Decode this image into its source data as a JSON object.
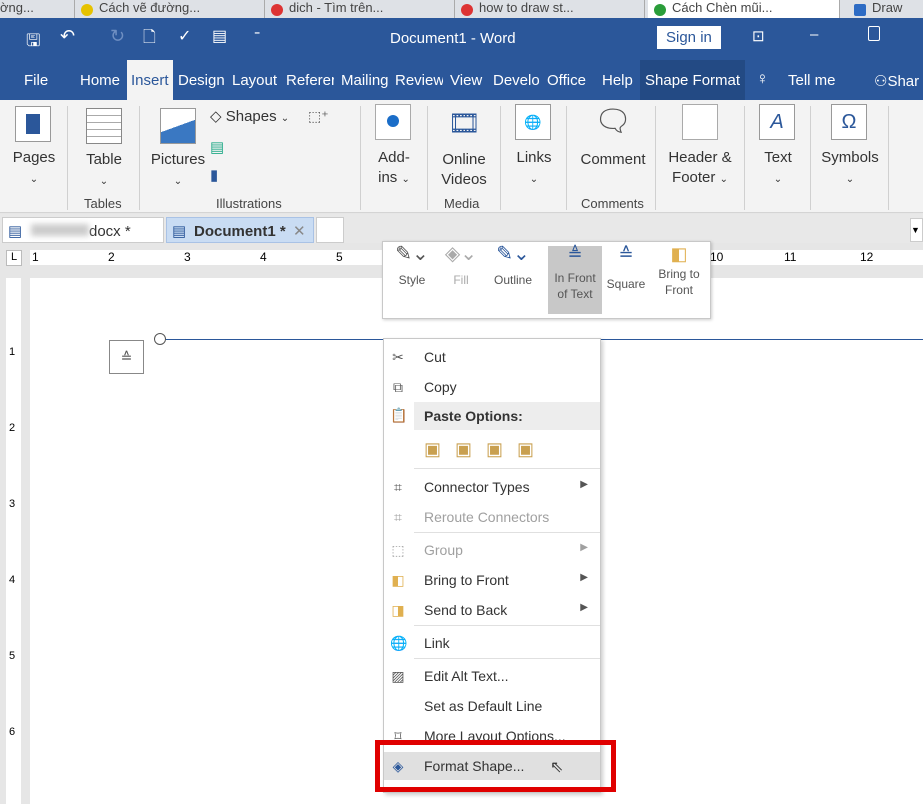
{
  "browser_tabs": [
    "ờng...",
    "Cách vẽ đường...",
    "dich - Tìm trên...",
    "how to draw st...",
    "Cách Chèn mũi...",
    "Draw"
  ],
  "title": {
    "doc": "Document1  -  Word",
    "sign_in": "Sign in"
  },
  "menu": [
    "File",
    "Home",
    "Insert",
    "Design",
    "Layout",
    "Referer",
    "Mailing",
    "Review",
    "View",
    "Develo",
    "Office",
    "Help",
    "Shape Format",
    "Tell me",
    "Shar"
  ],
  "ribbon": {
    "pages": "Pages",
    "table": "Table",
    "pictures": "Pictures",
    "shapes": "Shapes",
    "addins1": "Add-",
    "addins2": "ins",
    "online1": "Online",
    "online2": "Videos",
    "links": "Links",
    "comment": "Comment",
    "header1": "Header &",
    "header2": "Footer",
    "text": "Text",
    "symbols": "Symbols",
    "groups": {
      "tables": "Tables",
      "illustrations": "Illustrations",
      "media": "Media",
      "comments": "Comments"
    }
  },
  "doc_tabs": [
    {
      "label": "docx *"
    },
    {
      "label": "Document1 *"
    }
  ],
  "ruler": [
    "1",
    "2",
    "3",
    "4",
    "5",
    "10",
    "11",
    "12"
  ],
  "vruler": [
    "1",
    "2",
    "3",
    "4",
    "5",
    "6"
  ],
  "mini_toolbar": {
    "style": "Style",
    "fill": "Fill",
    "outline": "Outline",
    "infront1": "In Front",
    "infront2": "of Text",
    "square": "Square",
    "bring1": "Bring to",
    "bring2": "Front"
  },
  "context_menu": {
    "cut": "Cut",
    "copy": "Copy",
    "paste_options": "Paste Options:",
    "connector_types": "Connector Types",
    "reroute": "Reroute Connectors",
    "group": "Group",
    "bring_front": "Bring to Front",
    "send_back": "Send to Back",
    "link": "Link",
    "edit_alt": "Edit Alt Text...",
    "set_default": "Set as Default Line",
    "more_layout": "More Layout Options...",
    "format_shape": "Format Shape..."
  },
  "colors": {
    "accent": "#2b579a",
    "highlight": "#e00000"
  }
}
